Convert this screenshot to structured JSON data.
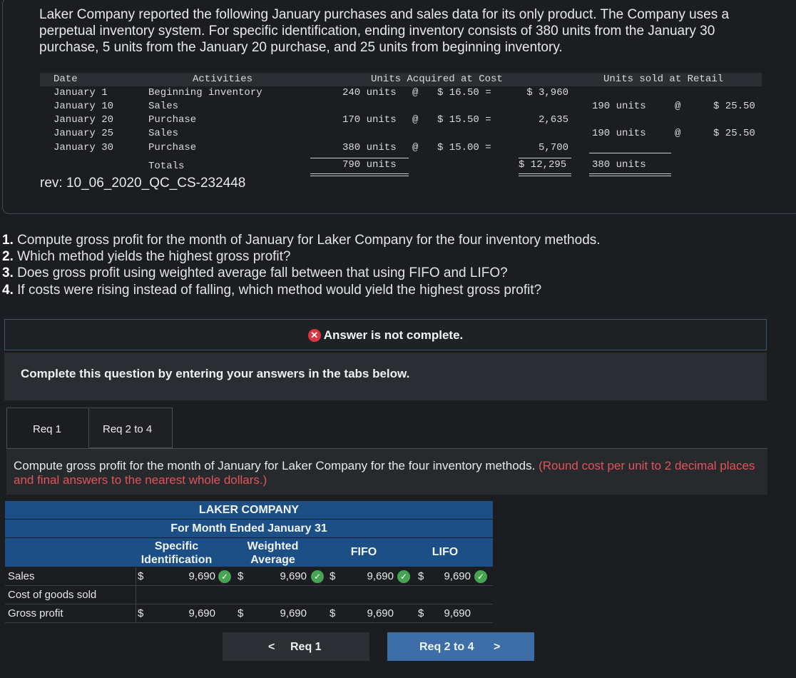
{
  "intro": "Laker Company reported the following January purchases and sales data for its only product. The Company uses a perpetual inventory system. For specific identification, ending inventory consists of 380 units from the January 30 purchase, 5 units from the January 20 purchase, and 25 units from beginning inventory.",
  "inventory_table": {
    "headers": {
      "date": "Date",
      "activities": "Activities",
      "acquired": "Units Acquired at Cost",
      "sold": "Units sold at Retail"
    },
    "rows": [
      {
        "date": "January 1",
        "activity": "Beginning inventory",
        "acq_units": "240 units",
        "acq_at": "@",
        "acq_cost": "$ 16.50 =",
        "acq_total": "$ 3,960",
        "sold_units": "",
        "sold_at": "",
        "sold_price": ""
      },
      {
        "date": "January 10",
        "activity": "Sales",
        "acq_units": "",
        "acq_at": "",
        "acq_cost": "",
        "acq_total": "",
        "sold_units": "190 units",
        "sold_at": "@",
        "sold_price": "$ 25.50"
      },
      {
        "date": "January 20",
        "activity": "Purchase",
        "acq_units": "170 units",
        "acq_at": "@",
        "acq_cost": "$ 15.50 =",
        "acq_total": "2,635",
        "sold_units": "",
        "sold_at": "",
        "sold_price": ""
      },
      {
        "date": "January 25",
        "activity": "Sales",
        "acq_units": "",
        "acq_at": "",
        "acq_cost": "",
        "acq_total": "",
        "sold_units": "190 units",
        "sold_at": "@",
        "sold_price": "$ 25.50"
      },
      {
        "date": "January 30",
        "activity": "Purchase",
        "acq_units": "380 units",
        "acq_at": "@",
        "acq_cost": "$ 15.00 =",
        "acq_total": "5,700",
        "sold_units": "",
        "sold_at": "",
        "sold_price": ""
      }
    ],
    "totals": {
      "label": "Totals",
      "acq_units": "790 units",
      "acq_total": "$ 12,295",
      "sold_units": "380 units"
    }
  },
  "rev": "rev: 10_06_2020_QC_CS-232448",
  "questions": [
    {
      "num": "1.",
      "text": " Compute gross profit for the month of January for Laker Company for the four inventory methods."
    },
    {
      "num": "2.",
      "text": " Which method yields the highest gross profit?"
    },
    {
      "num": "3.",
      "text": " Does gross profit using weighted average fall between that using FIFO and LIFO?"
    },
    {
      "num": "4.",
      "text": " If costs were rising instead of falling, which method would yield the highest gross profit?"
    }
  ],
  "notice": "Answer is not complete.",
  "instruction": "Complete this question by entering your answers in the tabs below.",
  "tabs": [
    "Req 1",
    "Req 2 to 4"
  ],
  "panel": {
    "text": "Compute gross profit for the month of January for Laker Company for the four inventory methods.",
    "hint": "(Round cost per unit to 2 decimal places and final answers to the nearest whole dollars.)"
  },
  "answer_table": {
    "company": "LAKER COMPANY",
    "period": "For Month Ended January 31",
    "columns": [
      {
        "line1": "Specific",
        "line2": "Identification"
      },
      {
        "line1": "Weighted",
        "line2": "Average"
      },
      {
        "line1": "FIFO",
        "line2": ""
      },
      {
        "line1": "LIFO",
        "line2": ""
      }
    ],
    "rows": [
      {
        "label": "Sales",
        "values": [
          "9,690",
          "9,690",
          "9,690",
          "9,690"
        ],
        "dollar": true,
        "checked": true
      },
      {
        "label": "Cost of goods sold",
        "values": [
          "",
          "",
          "",
          ""
        ],
        "dollar": false,
        "checked": false
      },
      {
        "label": "Gross profit",
        "values": [
          "9,690",
          "9,690",
          "9,690",
          "9,690"
        ],
        "dollar": true,
        "checked": false
      }
    ],
    "currency": "$",
    "check_glyph": "✓"
  },
  "nav": {
    "prev": "Req 1",
    "next": "Req 2 to 4",
    "prev_icon": "<",
    "next_icon": ">"
  },
  "colors": {
    "header_blue": "#1c4f86",
    "check_green": "#46a552",
    "error_red": "#d7373f",
    "hint_red": "#e2535a",
    "next_button": "#3e6ea8"
  }
}
